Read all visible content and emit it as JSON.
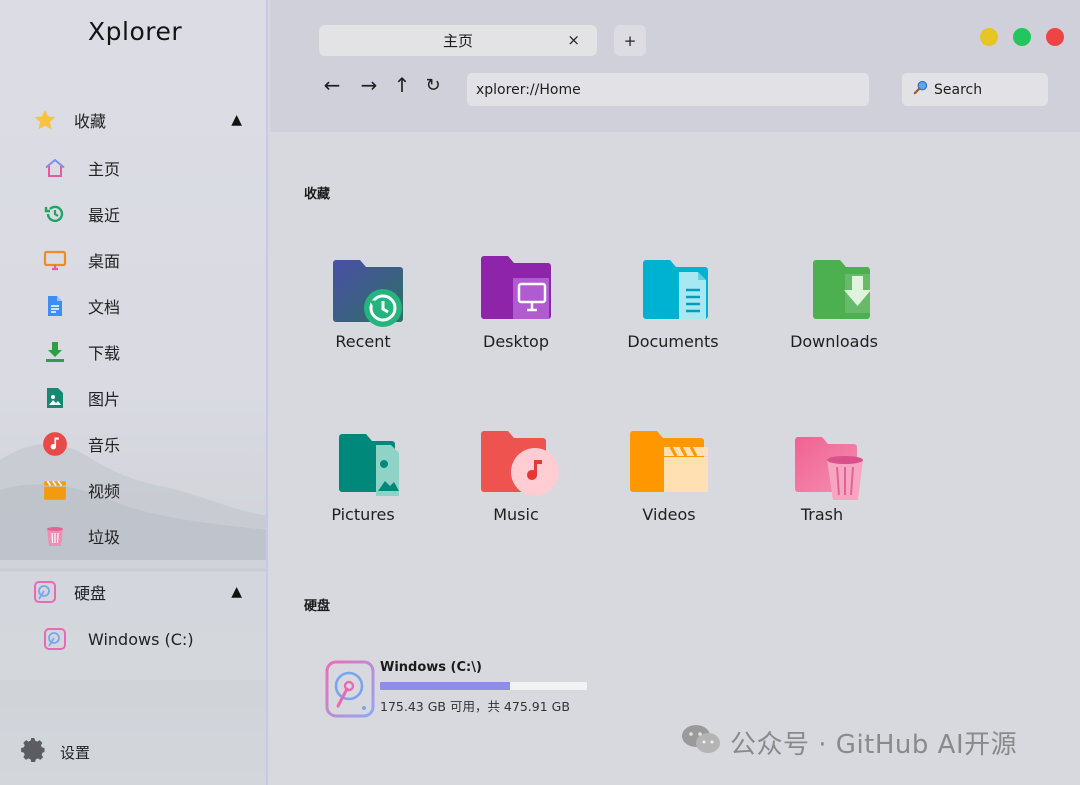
{
  "app": {
    "title": "Xplorer"
  },
  "sidebar": {
    "favorites_group": {
      "label": "收藏",
      "caret": "▲"
    },
    "favorites": [
      {
        "label": "主页",
        "icon": "home-icon"
      },
      {
        "label": "最近",
        "icon": "history-icon"
      },
      {
        "label": "桌面",
        "icon": "monitor-icon"
      },
      {
        "label": "文档",
        "icon": "document-icon"
      },
      {
        "label": "下载",
        "icon": "download-icon"
      },
      {
        "label": "图片",
        "icon": "image-icon"
      },
      {
        "label": "音乐",
        "icon": "music-icon"
      },
      {
        "label": "视频",
        "icon": "video-icon"
      },
      {
        "label": "垃圾",
        "icon": "trash-icon"
      }
    ],
    "drives_group": {
      "label": "硬盘",
      "caret": "▲"
    },
    "drives": [
      {
        "label": "Windows (C:)",
        "icon": "hard-drive-icon"
      }
    ],
    "settings_label": "设置"
  },
  "tabs": [
    {
      "label": "主页",
      "close": "×"
    }
  ],
  "new_tab_label": "+",
  "nav": {
    "back": "←",
    "forward": "→",
    "up": "↑",
    "refresh": "↻"
  },
  "address": {
    "value": "xplorer://Home"
  },
  "search": {
    "label": "Search"
  },
  "window_controls": {
    "minimize": "#e8c527",
    "maximize": "#22c55e",
    "close": "#ef4444"
  },
  "main": {
    "favorites_heading": "收藏",
    "favorites": [
      {
        "label": "Recent",
        "icon": "recent-folder-icon",
        "color": "#3f51b5"
      },
      {
        "label": "Desktop",
        "icon": "desktop-folder-icon",
        "color": "#8e24aa"
      },
      {
        "label": "Documents",
        "icon": "documents-folder-icon",
        "color": "#00acc1"
      },
      {
        "label": "Downloads",
        "icon": "downloads-folder-icon",
        "color": "#43a047"
      },
      {
        "label": "Pictures",
        "icon": "pictures-folder-icon",
        "color": "#00897b"
      },
      {
        "label": "Music",
        "icon": "music-folder-icon",
        "color": "#ef5350"
      },
      {
        "label": "Videos",
        "icon": "videos-folder-icon",
        "color": "#ff9800"
      },
      {
        "label": "Trash",
        "icon": "trash-folder-icon",
        "color": "#f06292"
      }
    ],
    "drives_heading": "硬盘",
    "drives": [
      {
        "name": "Windows (C:\\)",
        "info": "175.43 GB 可用，共 475.91 GB",
        "used_fraction": 0.63
      }
    ]
  },
  "watermark": {
    "text": "公众号 · GitHub AI开源"
  }
}
